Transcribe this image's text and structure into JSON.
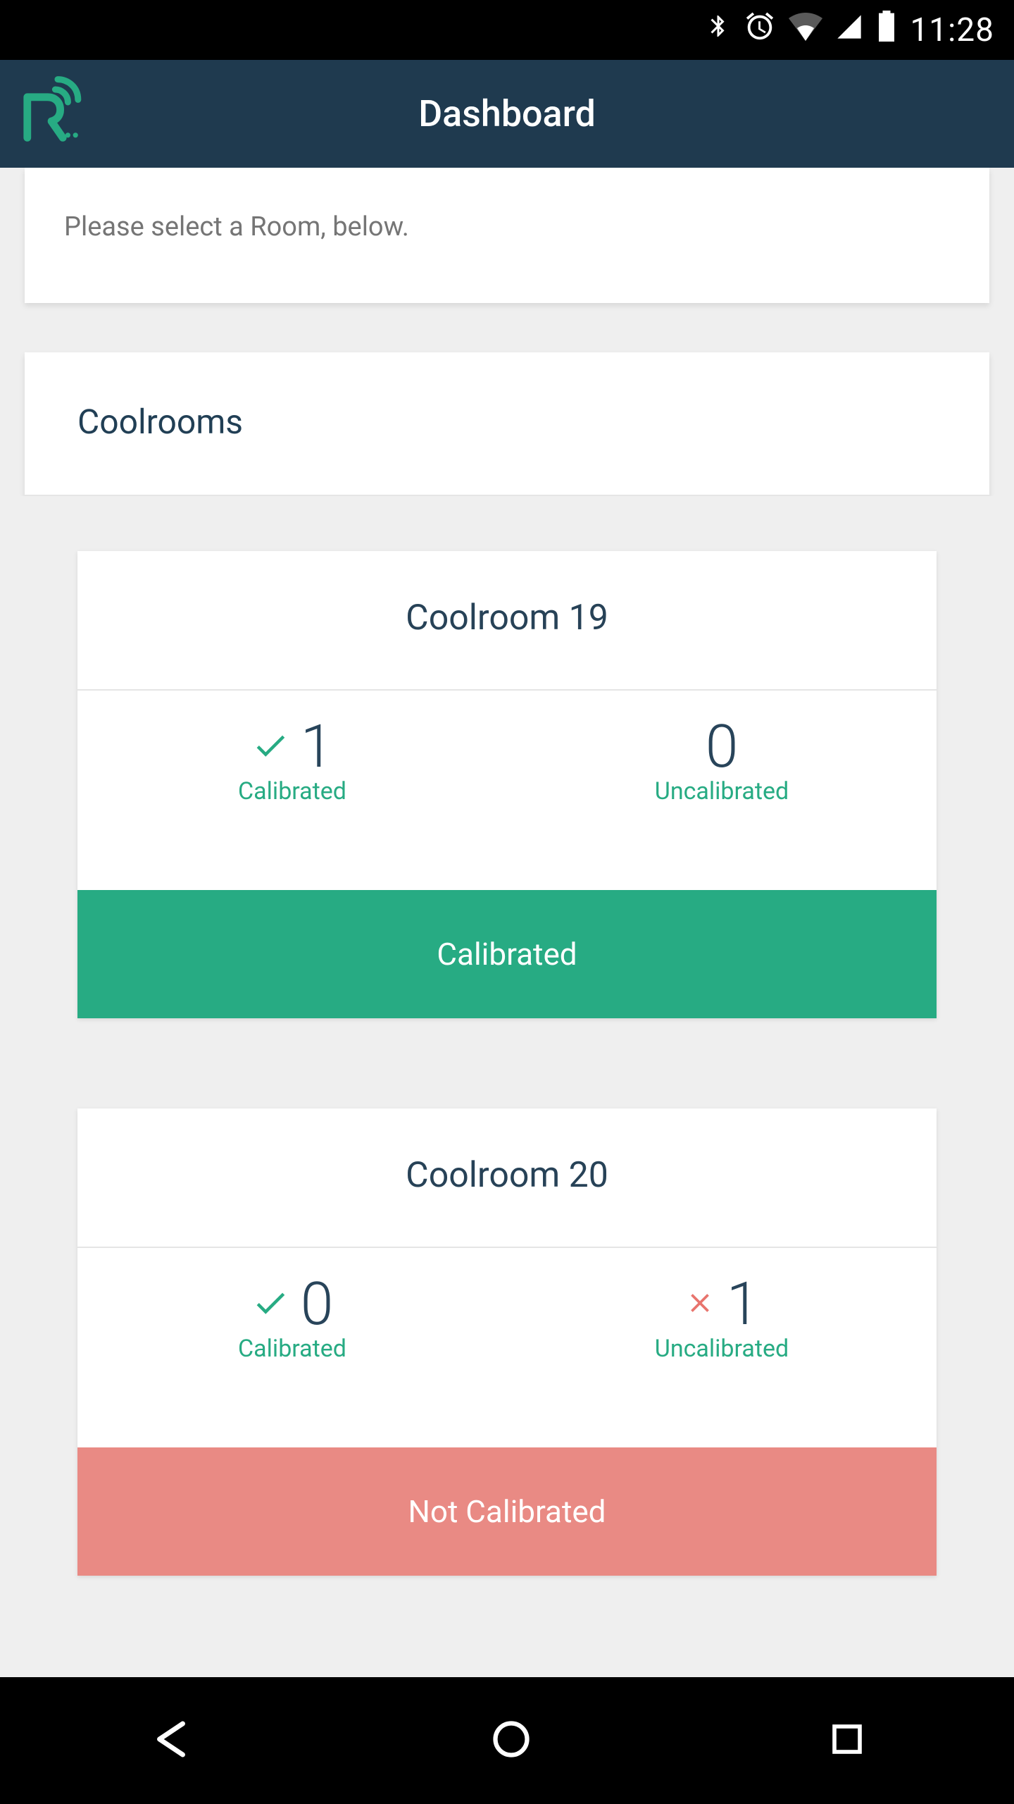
{
  "status": {
    "time": "11:28"
  },
  "header": {
    "title": "Dashboard"
  },
  "instruction": "Please select a Room, below.",
  "section": {
    "title": "Coolrooms"
  },
  "rooms": [
    {
      "name": "Coolroom 19",
      "calibrated_count": "1",
      "calibrated_label": "Calibrated",
      "uncalibrated_count": "0",
      "uncalibrated_label": "Uncalibrated",
      "show_check": true,
      "show_cross": false,
      "status_label": "Calibrated",
      "status_class": "status-calibrated"
    },
    {
      "name": "Coolroom 20",
      "calibrated_count": "0",
      "calibrated_label": "Calibrated",
      "uncalibrated_count": "1",
      "uncalibrated_label": "Uncalibrated",
      "show_check": true,
      "show_cross": true,
      "status_label": "Not Calibrated",
      "status_class": "status-not-calibrated"
    }
  ]
}
